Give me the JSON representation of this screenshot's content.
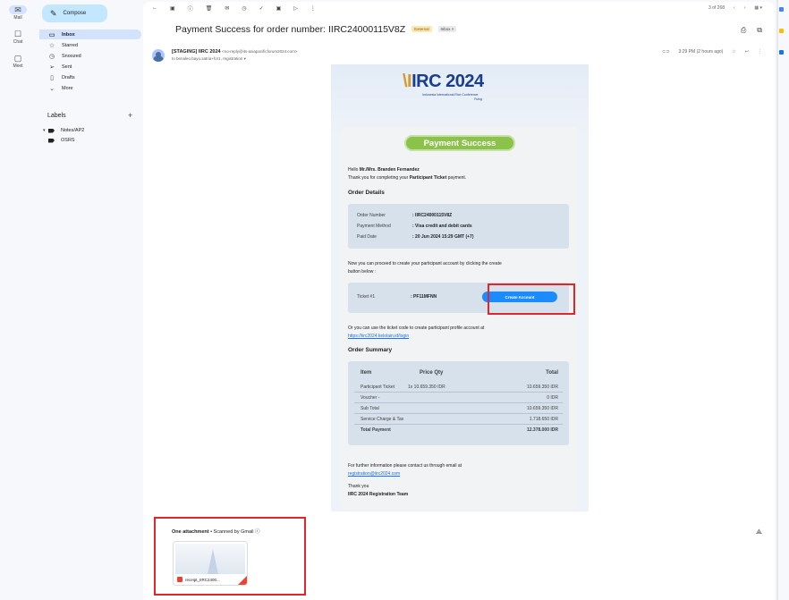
{
  "rail": {
    "items": [
      {
        "label": "Mail",
        "icon": "✉"
      },
      {
        "label": "Chat",
        "icon": "☐"
      },
      {
        "label": "Meet",
        "icon": "▢"
      }
    ]
  },
  "nav": {
    "compose": "Compose",
    "items": [
      {
        "label": "Inbox",
        "icon": "▭"
      },
      {
        "label": "Starred",
        "icon": "☆"
      },
      {
        "label": "Snoozed",
        "icon": "◷"
      },
      {
        "label": "Sent",
        "icon": "➢"
      },
      {
        "label": "Drafts",
        "icon": "▯"
      },
      {
        "label": "More",
        "icon": "⌄"
      }
    ],
    "labels_title": "Labels",
    "labels_plus": "+",
    "labels": [
      {
        "label": "Notes/AP2",
        "caret": "▾"
      },
      {
        "label": "OSRS",
        "caret": ""
      }
    ]
  },
  "toolbar": {
    "icons": [
      "←",
      "▣",
      "ⓘ",
      "🗑",
      "✉",
      "◷",
      "✓",
      "▣",
      "▷",
      "⋮"
    ],
    "counter": "3 of 268",
    "prev": "‹",
    "next": "›",
    "view": "▦ ▾"
  },
  "email": {
    "subject": "Payment Success for order number: IIRC24000115V8Z",
    "chip_external": "External",
    "chip_inbox": "Inbox ×",
    "print_icon": "⎙",
    "popout_icon": "⧉",
    "sender_name": "[STAGING] IIRC 2024",
    "sender_email": "<no-reply@its-asiapacificforum2024.com>",
    "to_line": "to benaleo.bayu.satria+for1, registration ▾",
    "time": "3:29 PM (2 hours ago)",
    "star": "☆",
    "reply": "↩",
    "more": "⋮",
    "clip": "⊂⊃"
  },
  "body": {
    "logo_main": "IRC 2024",
    "logo_prefix": "\\I",
    "logo_sub": "Indonesia International Rice Conference",
    "logo_sub2": "Pulog",
    "payment_success": "Payment Success",
    "greeting_prefix": "Hello ",
    "greeting_name": "Mr./Mrs. Branden Fernandez",
    "thanks_prefix": "Thank you for completing your ",
    "thanks_bold": "Participant Ticket",
    "thanks_suffix": " payment.",
    "order_details_title": "Order Details",
    "order": [
      {
        "k": "Order Number",
        "v": ":  IIRC24000115V8Z"
      },
      {
        "k": "Payment Method",
        "v": ":  Visa credit and debit cards"
      },
      {
        "k": "Paid Date",
        "v": ":  20 Jun 2024 15:29 GMT (+7)"
      }
    ],
    "proceed_1": "Now you can proceed to create your participant account by clicking the create",
    "proceed_2": "button below :",
    "ticket_label": "Ticket #1",
    "ticket_code": ":  PF11MFNN",
    "create_account": "Create Account",
    "alt_1": "Or you can use the ticket code to create participant profile account at",
    "alt_link": "https://iirc2024.kelolain.id/login",
    "summary_title": "Order Summary",
    "summary_head": {
      "item": "Item",
      "price": "Price Qty",
      "total": "Total"
    },
    "summary_rows": [
      {
        "item": "Participant Ticket",
        "price": "1x 10.659.350 IDR",
        "total": "10.659.350 IDR"
      },
      {
        "item": "Voucher -",
        "price": "",
        "total": "0 IDR"
      },
      {
        "item": "Sub Total",
        "price": "",
        "total": "10.659.350 IDR"
      },
      {
        "item": "Service Charge & Tax",
        "price": "",
        "total": "1.718.650 IDR"
      }
    ],
    "total_label": "Total Payment",
    "total_value": "12.378.000 IDR",
    "further": "For further information please contact us through email at",
    "contact_email": "registration@iirc2024.com",
    "thank_you": "Thank you",
    "team": "IIRC 2024 Registration Team"
  },
  "attachment": {
    "title_bold": "One attachment",
    "title_rest": " • Scanned by Gmail ⓘ",
    "file_name": "receipt_IIRC2400...",
    "drive_icon": "⟁"
  },
  "colors": {
    "accent": "#1a73e8",
    "success": "#8bc34a",
    "highlight": "#e0262b"
  }
}
